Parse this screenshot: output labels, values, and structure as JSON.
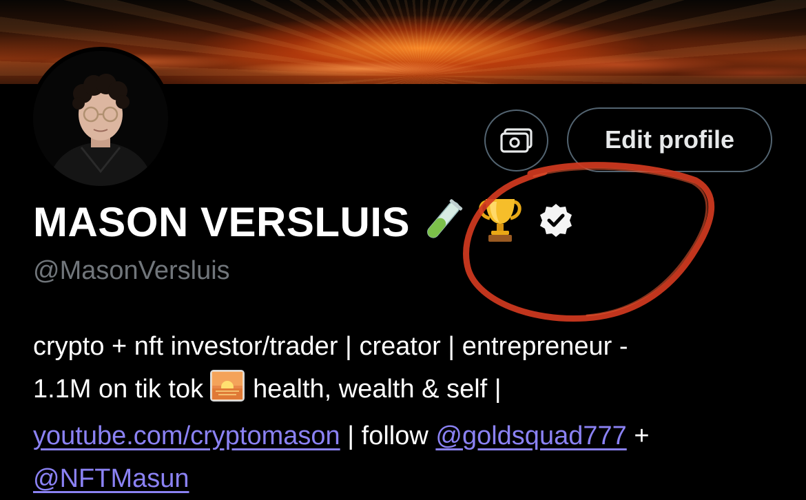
{
  "profile": {
    "name": "MASON VERSLUIS",
    "handle": "@MasonVersluis",
    "edit_button_label": "Edit profile"
  },
  "bio": {
    "line1": "crypto + nft investor/trader | creator | entrepreneur -",
    "line2_a": "1.1M on tik tok",
    "line2_b": "health, wealth & self |",
    "link_youtube": "youtube.com/cryptomason",
    "text_follow": "| follow",
    "mention_goldsquad": "@goldsquad777",
    "plus": "+",
    "mention_nftmasun": "@NFTMasun"
  },
  "icons": {
    "name_emojis": [
      "test-tube-icon",
      "trophy-icon",
      "verified-badge-icon"
    ],
    "action_icon": "money-icon",
    "bio_emoji": "sunrise-icon"
  },
  "colors": {
    "background": "#000000",
    "text": "#ffffff",
    "muted": "#71767b",
    "link": "#8b82f4",
    "border": "#536471",
    "annotation": "#d13a1f"
  }
}
